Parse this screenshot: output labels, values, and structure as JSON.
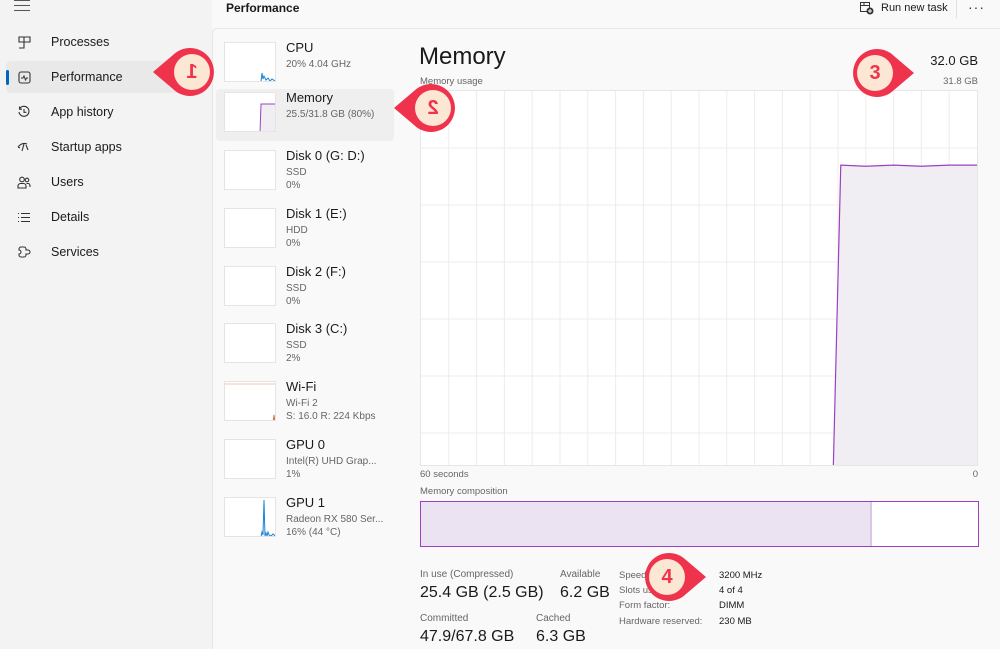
{
  "sidebar": {
    "menu_icon": "hamburger-icon",
    "items": [
      {
        "label": "Processes",
        "icon": "processes-icon",
        "active": false
      },
      {
        "label": "Performance",
        "icon": "performance-icon",
        "active": true
      },
      {
        "label": "App history",
        "icon": "app-history-icon",
        "active": false
      },
      {
        "label": "Startup apps",
        "icon": "startup-apps-icon",
        "active": false
      },
      {
        "label": "Users",
        "icon": "users-icon",
        "active": false
      },
      {
        "label": "Details",
        "icon": "details-icon",
        "active": false
      },
      {
        "label": "Services",
        "icon": "services-icon",
        "active": false
      }
    ]
  },
  "header": {
    "title": "Performance",
    "run_new_task": "Run new task",
    "more": "···"
  },
  "devices": [
    {
      "name": "CPU",
      "sub1": "20%  4.04 GHz",
      "sub2": "",
      "selected": false
    },
    {
      "name": "Memory",
      "sub1": "25.5/31.8 GB (80%)",
      "sub2": "",
      "selected": true
    },
    {
      "name": "Disk 0 (G: D:)",
      "sub1": "SSD",
      "sub2": "0%",
      "selected": false
    },
    {
      "name": "Disk 1 (E:)",
      "sub1": "HDD",
      "sub2": "0%",
      "selected": false
    },
    {
      "name": "Disk 2 (F:)",
      "sub1": "SSD",
      "sub2": "0%",
      "selected": false
    },
    {
      "name": "Disk 3 (C:)",
      "sub1": "SSD",
      "sub2": "2%",
      "selected": false
    },
    {
      "name": "Wi-Fi",
      "sub1": "Wi-Fi 2",
      "sub2": "S: 16.0  R: 224 Kbps",
      "selected": false
    },
    {
      "name": "GPU 0",
      "sub1": "Intel(R) UHD Grap...",
      "sub2": "1%",
      "selected": false
    },
    {
      "name": "GPU 1",
      "sub1": "Radeon RX 580 Ser...",
      "sub2": "16%  (44 °C)",
      "selected": false
    }
  ],
  "memory": {
    "title": "Memory",
    "total": "32.0 GB",
    "usage_label": "Memory usage",
    "max_label": "31.8 GB",
    "axis_left": "60 seconds",
    "axis_right": "0",
    "composition_label": "Memory composition",
    "composition": {
      "in_use_fraction": 0.806,
      "modified_fraction": 0.004
    },
    "stats": {
      "in_use_label": "In use (Compressed)",
      "in_use_value": "25.4 GB (2.5 GB)",
      "available_label": "Available",
      "available_value": "6.2 GB",
      "committed_label": "Committed",
      "committed_value": "47.9/67.8 GB",
      "cached_label": "Cached",
      "cached_value": "6.3 GB"
    },
    "specs": [
      {
        "label": "Speed:",
        "value": "3200 MHz"
      },
      {
        "label": "Slots used:",
        "value": "4 of 4"
      },
      {
        "label": "Form factor:",
        "value": "DIMM"
      },
      {
        "label": "Hardware reserved:",
        "value": "230 MB"
      }
    ]
  },
  "chart_data": {
    "type": "area",
    "title": "Memory usage",
    "xlabel": "",
    "ylabel": "",
    "x_range_seconds": [
      60,
      0
    ],
    "ylim_gb": [
      0,
      31.8
    ],
    "grid": true,
    "series": [
      {
        "name": "Memory usage (GB)",
        "x_seconds_ago": [
          60,
          15.5,
          15.5,
          14.7,
          12,
          9,
          6,
          3,
          0
        ],
        "values": [
          0,
          0,
          0,
          25.5,
          25.4,
          25.5,
          25.4,
          25.5,
          25.5
        ]
      }
    ],
    "color": "#9b40c0",
    "fill_color": "#f1eef3"
  },
  "annotations": [
    {
      "label": "1",
      "direction": "left"
    },
    {
      "label": "2",
      "direction": "left"
    },
    {
      "label": "3",
      "direction": "right"
    },
    {
      "label": "4",
      "direction": "right"
    }
  ],
  "colors": {
    "accent": "#0067c0",
    "memory": "#9b40c0",
    "badge_ring": "#f0334d",
    "badge_fill": "#fbe7d4"
  }
}
